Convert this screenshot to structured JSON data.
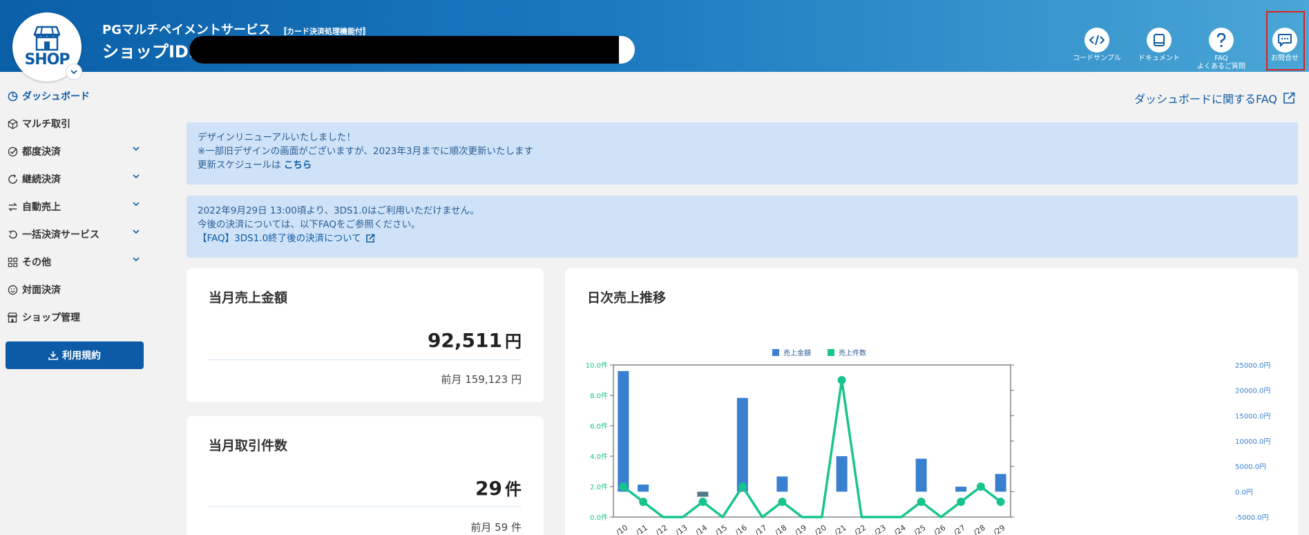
{
  "header": {
    "logo_text": "SHOP",
    "service_name": "PGマルチペイメントサービス",
    "service_sub": "〚カード決済処理機能付〛",
    "shop_id_label": "ショップID:",
    "buttons": [
      {
        "label": "コードサンプル",
        "icon": "code-icon"
      },
      {
        "label": "ドキュメント",
        "icon": "book-icon"
      },
      {
        "label": "FAQ",
        "label2": "よくあるご質問",
        "icon": "question-icon"
      },
      {
        "label": "お問合せ",
        "icon": "chat-icon"
      }
    ]
  },
  "sidebar": {
    "items": [
      {
        "label": "ダッシュボード",
        "icon": "dashboard-icon",
        "active": true
      },
      {
        "label": "マルチ取引",
        "icon": "cube-icon"
      },
      {
        "label": "都度決済",
        "icon": "check-circle-icon",
        "expandable": true
      },
      {
        "label": "継続決済",
        "icon": "recurring-icon",
        "expandable": true
      },
      {
        "label": "自動売上",
        "icon": "swap-icon",
        "expandable": true
      },
      {
        "label": "一括決済サービス",
        "icon": "undo-icon",
        "expandable": true
      },
      {
        "label": "その他",
        "icon": "grid-icon",
        "expandable": true
      },
      {
        "label": "対面決済",
        "icon": "smile-icon"
      },
      {
        "label": "ショップ管理",
        "icon": "store-icon"
      }
    ],
    "terms_button": "利用規約"
  },
  "main": {
    "faq_link": "ダッシュボードに関するFAQ",
    "notice1": {
      "line1": "デザインリニューアルいたしました！",
      "line2": "※一部旧デザインの画面がございますが、2023年3月までに順次更新いたします",
      "line3": "更新スケジュールは",
      "link": "こちら"
    },
    "notice2": {
      "line1": "2022年9月29日 13:00頃より、3DS1.0はご利用いただけません。",
      "line2": "今後の決済については、以下FAQをご参照ください。",
      "link": "【FAQ】3DS1.0終了後の決済について"
    },
    "sales_card": {
      "title": "当月売上金額",
      "value": "92,511",
      "unit": "円",
      "prev": "前月 159,123 円"
    },
    "count_card": {
      "title": "当月取引件数",
      "value": "29",
      "unit": "件",
      "prev": "前月 59 件"
    },
    "chart_card": {
      "title": "日次売上推移"
    }
  },
  "chart_data": {
    "type": "bar+line",
    "categories": [
      "/10",
      "/11",
      "/12",
      "/13",
      "/14",
      "/15",
      "/16",
      "/17",
      "/18",
      "/19",
      "/20",
      "/21",
      "/22",
      "/23",
      "/24",
      "/25",
      "/26",
      "/27",
      "/28",
      "/29"
    ],
    "series": [
      {
        "name": "売上金額",
        "type": "bar",
        "axis": "right",
        "color": "#3a80d0",
        "values": [
          23800,
          1400,
          0,
          0,
          -1000,
          0,
          18500,
          0,
          3000,
          0,
          0,
          7000,
          0,
          0,
          0,
          6500,
          0,
          1000,
          0,
          3500
        ]
      },
      {
        "name": "売上件数",
        "type": "line",
        "axis": "left",
        "color": "#17c48e",
        "values": [
          2,
          1,
          0,
          0,
          1,
          0,
          2,
          0,
          1,
          0,
          0,
          9,
          0,
          0,
          0,
          1,
          0,
          1,
          2,
          1
        ]
      }
    ],
    "y_left": {
      "ticks": [
        "0.0件",
        "2.0件",
        "4.0件",
        "6.0件",
        "8.0件",
        "10.0件"
      ],
      "range": [
        0,
        10
      ]
    },
    "y_right": {
      "ticks": [
        "-5000.0円",
        "0.0円",
        "5000.0円",
        "10000.0円",
        "15000.0円",
        "20000.0円",
        "25000.0円"
      ],
      "range": [
        -5000,
        25000
      ]
    },
    "legend": "top",
    "colors": {
      "bar": "#3a80d0",
      "line": "#17c48e",
      "left_axis": "#17c48e",
      "right_axis": "#3a80d0"
    }
  }
}
